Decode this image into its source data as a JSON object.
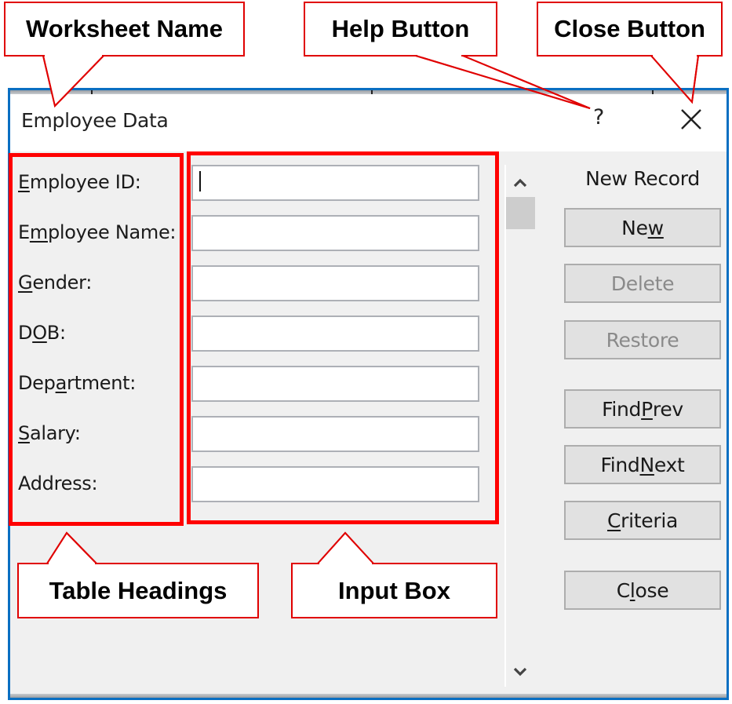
{
  "dialog": {
    "title": "Employee Data",
    "help_label": "?",
    "close_icon": "close-x-icon",
    "border_color": "#0a6fc2",
    "background_color": "#f0f0f0"
  },
  "fields": [
    {
      "label_pre": "",
      "label_key": "E",
      "label_post": "mployee ID:",
      "value": "",
      "has_focus": true
    },
    {
      "label_pre": "E",
      "label_key": "m",
      "label_post": "ployee Name:",
      "value": "",
      "has_focus": false
    },
    {
      "label_pre": "",
      "label_key": "G",
      "label_post": "ender:",
      "value": "",
      "has_focus": false
    },
    {
      "label_pre": "D",
      "label_key": "O",
      "label_post": "B:",
      "value": "",
      "has_focus": false
    },
    {
      "label_pre": "Dep",
      "label_key": "a",
      "label_post": "rtment:",
      "value": "",
      "has_focus": false
    },
    {
      "label_pre": "",
      "label_key": "S",
      "label_post": "alary:",
      "value": "",
      "has_focus": false
    },
    {
      "label_pre": "Address:",
      "label_key": "",
      "label_post": "",
      "value": "",
      "has_focus": false
    }
  ],
  "record_status": "New Record",
  "buttons": [
    {
      "pre": "Ne",
      "key": "w",
      "post": "",
      "enabled": true
    },
    {
      "pre": "Delete",
      "key": "",
      "post": "",
      "enabled": false
    },
    {
      "pre": "Restore",
      "key": "",
      "post": "",
      "enabled": false
    },
    {
      "pre": "Find ",
      "key": "P",
      "post": "rev",
      "enabled": true
    },
    {
      "pre": "Find ",
      "key": "N",
      "post": "ext",
      "enabled": true
    },
    {
      "pre": "",
      "key": "C",
      "post": "riteria",
      "enabled": true
    },
    {
      "pre": "C",
      "key": "l",
      "post": "ose",
      "enabled": true
    }
  ],
  "scrollbar": {
    "up_icon": "chevron-up-icon",
    "down_icon": "chevron-down-icon"
  },
  "annotations": {
    "worksheet_name": "Worksheet Name",
    "help_button": "Help Button",
    "close_button": "Close Button",
    "table_headings": "Table Headings",
    "input_box": "Input Box",
    "color": "#ff0000"
  }
}
